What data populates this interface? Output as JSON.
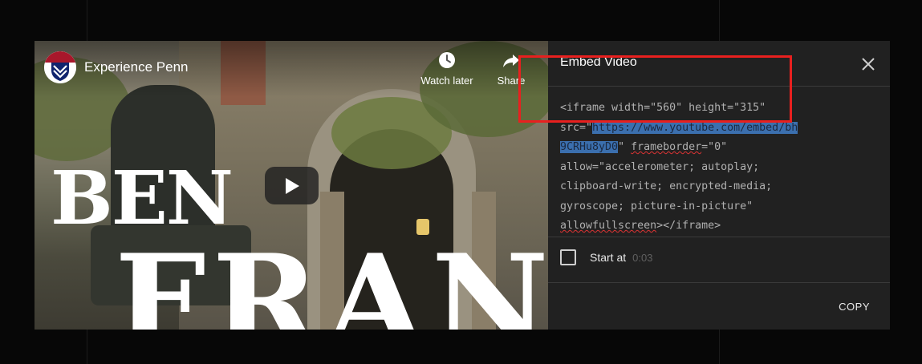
{
  "video": {
    "channel_title": "Experience Penn",
    "overlay_text_line1": "BEN",
    "overlay_text_line2": "FRAN",
    "watch_later_label": "Watch later",
    "share_label": "Share",
    "icons": [
      "clock-icon",
      "share-arrow-icon",
      "play-icon",
      "penn-shield-icon"
    ]
  },
  "embed_panel": {
    "title": "Embed Video",
    "code_lines": [
      {
        "pre": "<iframe width=\"560\" height=\"315\"",
        "hl": "",
        "post": ""
      },
      {
        "pre": "src=\"",
        "hl": "https://www.youtube.com/embed/bh",
        "post": ""
      },
      {
        "pre": "",
        "hl": "9CRHu8yD0",
        "post": "\" ",
        "squig": "frameborder",
        "tail": "=\"0\""
      },
      {
        "pre": "allow=\"accelerometer; autoplay;",
        "hl": "",
        "post": ""
      },
      {
        "pre": "clipboard-write; encrypted-media;",
        "hl": "",
        "post": ""
      },
      {
        "pre": "gyroscope; picture-in-picture\"",
        "hl": "",
        "post": ""
      },
      {
        "pre": "",
        "hl": "",
        "post": "",
        "squig": "allowfullscreen",
        "tail": "></iframe>"
      }
    ],
    "start_at_label": "Start at",
    "start_at_time": "0:03",
    "start_at_checked": false,
    "copy_label": "COPY"
  },
  "colors": {
    "panel_bg": "#212121",
    "highlight": "#3b6fae",
    "annotation_box": "#e8201f"
  }
}
